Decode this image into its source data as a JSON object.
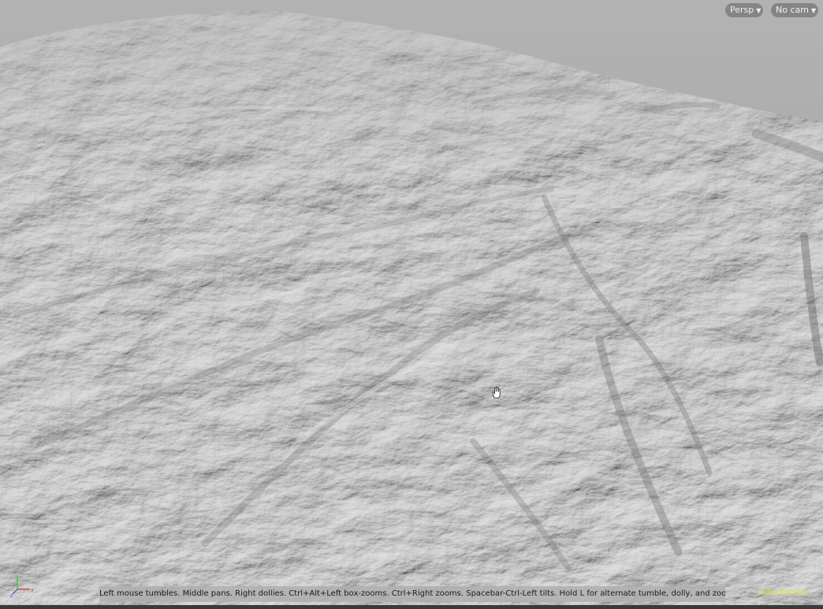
{
  "viewport": {
    "camera_mode_label": "Persp",
    "camera_select_label": "No cam",
    "hint_text": "Left mouse tumbles. Middle pans. Right dollies. Ctrl+Alt+Left box-zooms. Ctrl+Right zooms. Spacebar-Ctrl-Left tilts. Hold L for alternate tumble, dolly, and zoom.",
    "edition_label": "Indie Edition",
    "colors": {
      "edition_text": "#e0e033",
      "terrain_base": "#c8c8c8",
      "sky": "#a9a9a9"
    },
    "icons": {
      "axes": "axes-gizmo-icon",
      "cursor": "hand-cursor-icon"
    }
  }
}
